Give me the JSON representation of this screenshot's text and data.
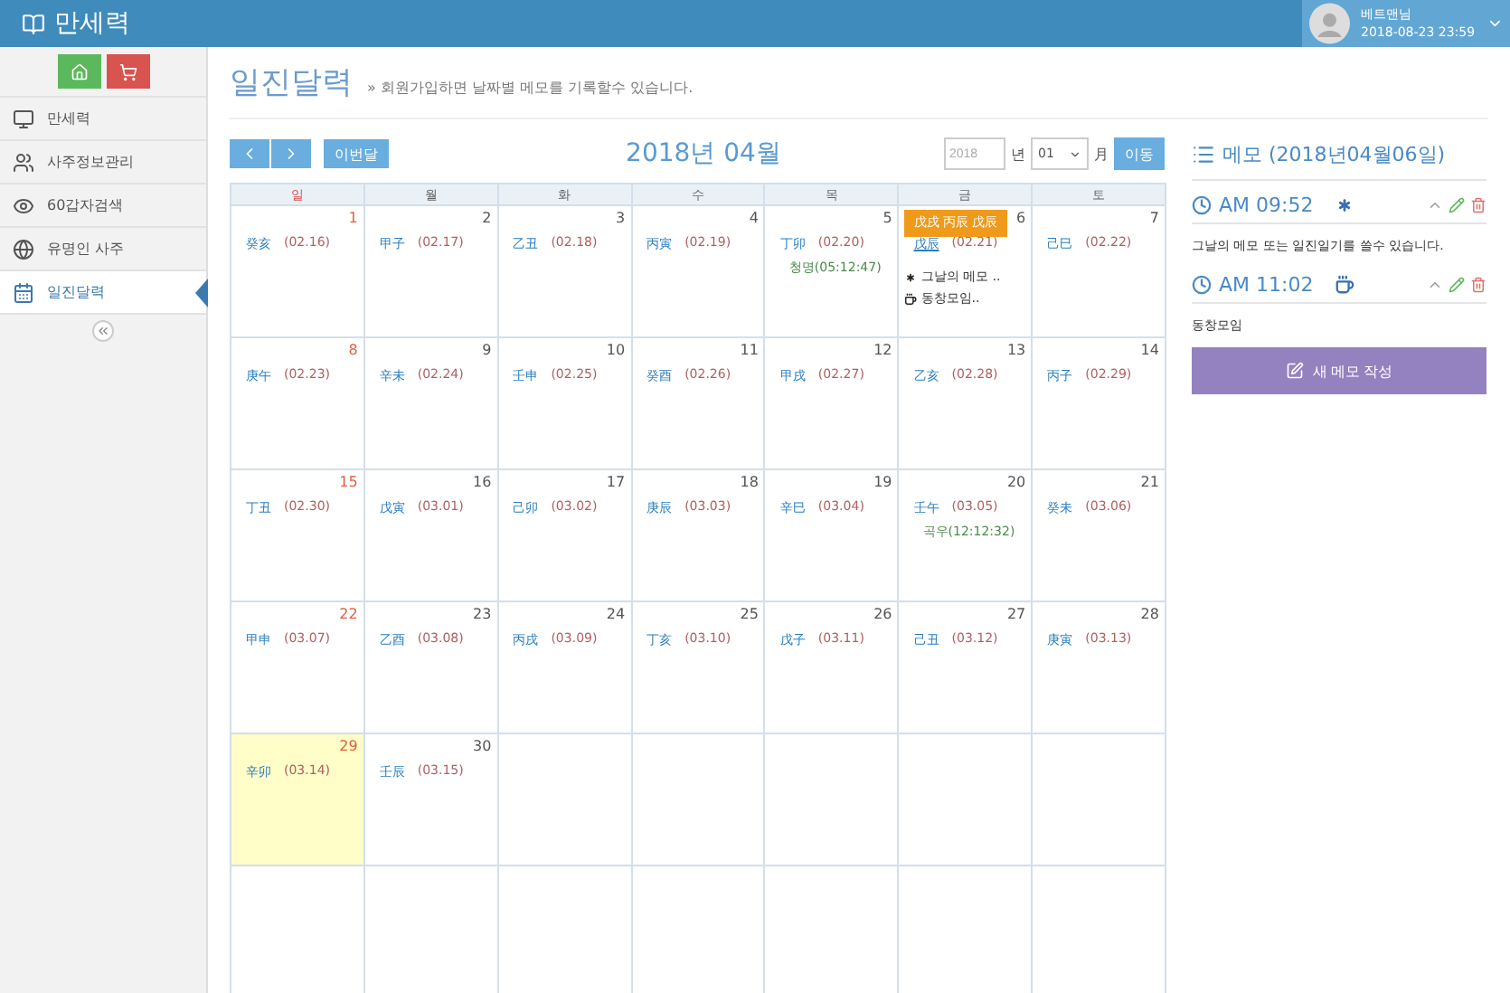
{
  "app": {
    "title": "만세력"
  },
  "user": {
    "name": "베트맨님",
    "datetime": "2018-08-23 23:59"
  },
  "sidebar": {
    "items": [
      {
        "label": "만세력",
        "selected": false
      },
      {
        "label": "사주정보관리",
        "selected": false
      },
      {
        "label": "60갑자검색",
        "selected": false
      },
      {
        "label": "유명인 사주",
        "selected": false
      },
      {
        "label": "일진달력",
        "selected": true
      }
    ]
  },
  "page": {
    "title": "일진달력",
    "subtitle": "» 회원가입하면 날짜별 메모를 기록할수 있습니다."
  },
  "toolbar": {
    "today_button": "이번달",
    "month_title": "2018년 04월",
    "year_placeholder": "2018",
    "year_unit": "년",
    "month_value": "01",
    "month_unit": "月",
    "go_button": "이동"
  },
  "calendar": {
    "weekdays": [
      "일",
      "월",
      "화",
      "수",
      "목",
      "금",
      "토"
    ],
    "weeks": [
      [
        {
          "day": "1",
          "ganji": "癸亥",
          "lunar": "(02.16)",
          "highlighted": false
        },
        {
          "day": "2",
          "ganji": "甲子",
          "lunar": "(02.17)",
          "highlighted": false
        },
        {
          "day": "3",
          "ganji": "乙丑",
          "lunar": "(02.18)",
          "highlighted": false
        },
        {
          "day": "4",
          "ganji": "丙寅",
          "lunar": "(02.19)",
          "highlighted": false
        },
        {
          "day": "5",
          "ganji": "丁卯",
          "lunar": "(02.20)",
          "term": "청명(05:12:47)",
          "highlighted": false
        },
        {
          "day": "6",
          "ganji": "戊辰",
          "lunar": "(02.21)",
          "highlighted": false,
          "tooltip": "戊戌 丙辰 戊辰",
          "memos": [
            {
              "kind": "star",
              "text": "그날의 메모 .."
            },
            {
              "kind": "coffee",
              "text": "동창모임.."
            }
          ]
        },
        {
          "day": "7",
          "ganji": "己巳",
          "lunar": "(02.22)",
          "highlighted": false
        }
      ],
      [
        {
          "day": "8",
          "ganji": "庚午",
          "lunar": "(02.23)",
          "highlighted": false
        },
        {
          "day": "9",
          "ganji": "辛未",
          "lunar": "(02.24)",
          "highlighted": false
        },
        {
          "day": "10",
          "ganji": "壬申",
          "lunar": "(02.25)",
          "highlighted": false
        },
        {
          "day": "11",
          "ganji": "癸酉",
          "lunar": "(02.26)",
          "highlighted": false
        },
        {
          "day": "12",
          "ganji": "甲戌",
          "lunar": "(02.27)",
          "highlighted": false
        },
        {
          "day": "13",
          "ganji": "乙亥",
          "lunar": "(02.28)",
          "highlighted": false
        },
        {
          "day": "14",
          "ganji": "丙子",
          "lunar": "(02.29)",
          "highlighted": false
        }
      ],
      [
        {
          "day": "15",
          "ganji": "丁丑",
          "lunar": "(02.30)",
          "highlighted": false
        },
        {
          "day": "16",
          "ganji": "戊寅",
          "lunar": "(03.01)",
          "highlighted": false
        },
        {
          "day": "17",
          "ganji": "己卯",
          "lunar": "(03.02)",
          "highlighted": false
        },
        {
          "day": "18",
          "ganji": "庚辰",
          "lunar": "(03.03)",
          "highlighted": false
        },
        {
          "day": "19",
          "ganji": "辛巳",
          "lunar": "(03.04)",
          "highlighted": false
        },
        {
          "day": "20",
          "ganji": "壬午",
          "lunar": "(03.05)",
          "term": "곡우(12:12:32)",
          "highlighted": false
        },
        {
          "day": "21",
          "ganji": "癸未",
          "lunar": "(03.06)",
          "highlighted": false
        }
      ],
      [
        {
          "day": "22",
          "ganji": "甲申",
          "lunar": "(03.07)",
          "highlighted": false
        },
        {
          "day": "23",
          "ganji": "乙酉",
          "lunar": "(03.08)",
          "highlighted": false
        },
        {
          "day": "24",
          "ganji": "丙戌",
          "lunar": "(03.09)",
          "highlighted": false
        },
        {
          "day": "25",
          "ganji": "丁亥",
          "lunar": "(03.10)",
          "highlighted": false
        },
        {
          "day": "26",
          "ganji": "戊子",
          "lunar": "(03.11)",
          "highlighted": false
        },
        {
          "day": "27",
          "ganji": "己丑",
          "lunar": "(03.12)",
          "highlighted": false
        },
        {
          "day": "28",
          "ganji": "庚寅",
          "lunar": "(03.13)",
          "highlighted": false
        }
      ],
      [
        {
          "day": "29",
          "ganji": "辛卯",
          "lunar": "(03.14)",
          "highlighted": true
        },
        {
          "day": "30",
          "ganji": "壬辰",
          "lunar": "(03.15)",
          "highlighted": false
        }
      ]
    ]
  },
  "memo_panel": {
    "title": "메모 (2018년04월06일)",
    "entries": [
      {
        "time": "AM 09:52",
        "kind": "star",
        "text": "그날의 메모 또는 일진일기를 쓸수 있습니다."
      },
      {
        "time": "AM 11:02",
        "kind": "coffee",
        "text": "동창모임"
      }
    ],
    "new_button": "새 메모 작성"
  }
}
